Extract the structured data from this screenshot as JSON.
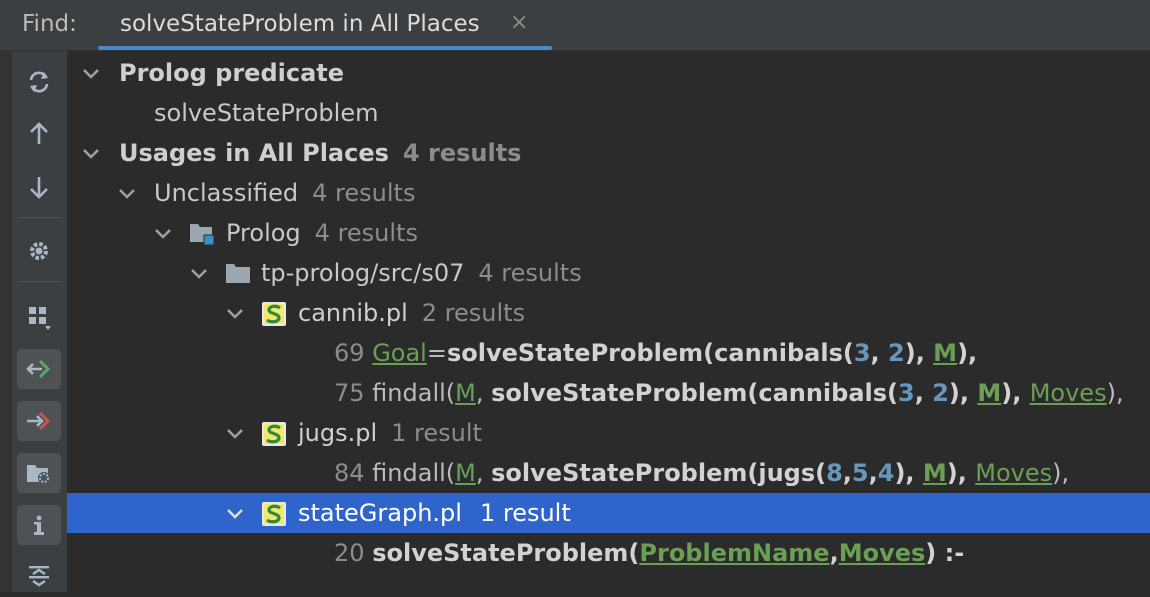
{
  "header": {
    "find_label": "Find:",
    "tab_title": "solveStateProblem in All Places",
    "close_glyph": "×"
  },
  "toolbar": {
    "icons": [
      "refresh-icon",
      "arrow-up-icon",
      "arrow-down-icon",
      "gear-icon",
      "group-by-icon",
      "navigate-previous-icon",
      "navigate-next-icon",
      "folder-filter-icon",
      "info-icon",
      "expand-all-icon"
    ]
  },
  "tree": {
    "target_group": "Prolog predicate",
    "target_name": "solveStateProblem",
    "usages_label": "Usages in All Places",
    "usages_count": "4 results",
    "unclassified_label": "Unclassified",
    "unclassified_count": "4 results",
    "prolog_label": "Prolog",
    "prolog_count": "4 results",
    "dir_label": "tp-prolog/src/s07",
    "dir_count": "4 results",
    "files": [
      {
        "name": "cannib.pl",
        "count": "2 results",
        "lines": [
          {
            "num": "69",
            "s1": " ",
            "v1": "Goal",
            "s2": "=",
            "pred": "solveStateProblem(cannibals(",
            "n1": "3",
            "c1": ", ",
            "n2": "2",
            "c2": "), ",
            "v2": "M",
            "c3": "),",
            "v3": "",
            "c4": ""
          },
          {
            "num": "75",
            "s1": " findall(",
            "v1": "M",
            "s2": ", ",
            "pred": "solveStateProblem(cannibals(",
            "n1": "3",
            "c1": ", ",
            "n2": "2",
            "c2": "), ",
            "v2": "M",
            "c3": "), ",
            "v3": "Moves",
            "c4": "),"
          }
        ]
      },
      {
        "name": "jugs.pl",
        "count": "1 result",
        "lines": [
          {
            "num": "84",
            "s1": " findall(",
            "v1": "M",
            "s2": ", ",
            "pred": "solveStateProblem(jugs(",
            "n1": "8",
            "c1": ",",
            "n2": "5",
            "c2": ",",
            "n3": "4",
            "c2b": "), ",
            "v2": "M",
            "c3": "), ",
            "v3": "Moves",
            "c4": "),"
          }
        ]
      },
      {
        "name": "stateGraph.pl",
        "count": "1 result",
        "lines": [
          {
            "num": "20",
            "pred": "solveStateProblem(",
            "v1": "ProblemName",
            "s2": ",",
            "v2": "Moves",
            "c3": ") :-"
          }
        ]
      }
    ]
  },
  "colors": {
    "background": "#2b2b2b",
    "selection": "#2f65ca",
    "variable": "#6a9f55",
    "number": "#6897bb",
    "tab_underline": "#4a88c7"
  }
}
